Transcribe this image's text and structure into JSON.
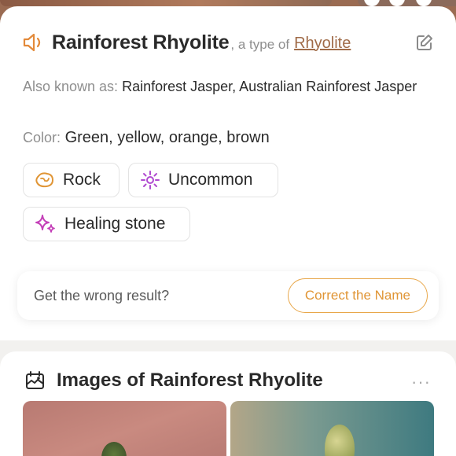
{
  "header": {
    "name": "Rainforest Rhyolite",
    "type_of_prefix": ", a type of",
    "type_of_link": "Rhyolite"
  },
  "details": {
    "aka_label": "Also known as:",
    "aka_value": "Rainforest Jasper, Australian Rainforest Jasper",
    "color_label": "Color:",
    "color_value": "Green, yellow, orange, brown"
  },
  "tags": [
    {
      "label": "Rock",
      "icon": "rock-icon",
      "color": "#e09535"
    },
    {
      "label": "Uncommon",
      "icon": "sparkle-dot-icon",
      "color": "#b04ad0"
    },
    {
      "label": "Healing stone",
      "icon": "sparkles-icon",
      "color": "#c43fb8"
    }
  ],
  "feedback": {
    "question": "Get the wrong result?",
    "button_label": "Correct the Name"
  },
  "images_section": {
    "title": "Images of Rainforest Rhyolite",
    "more": "···"
  },
  "colors": {
    "accent": "#e09535",
    "link": "#a06b48"
  }
}
